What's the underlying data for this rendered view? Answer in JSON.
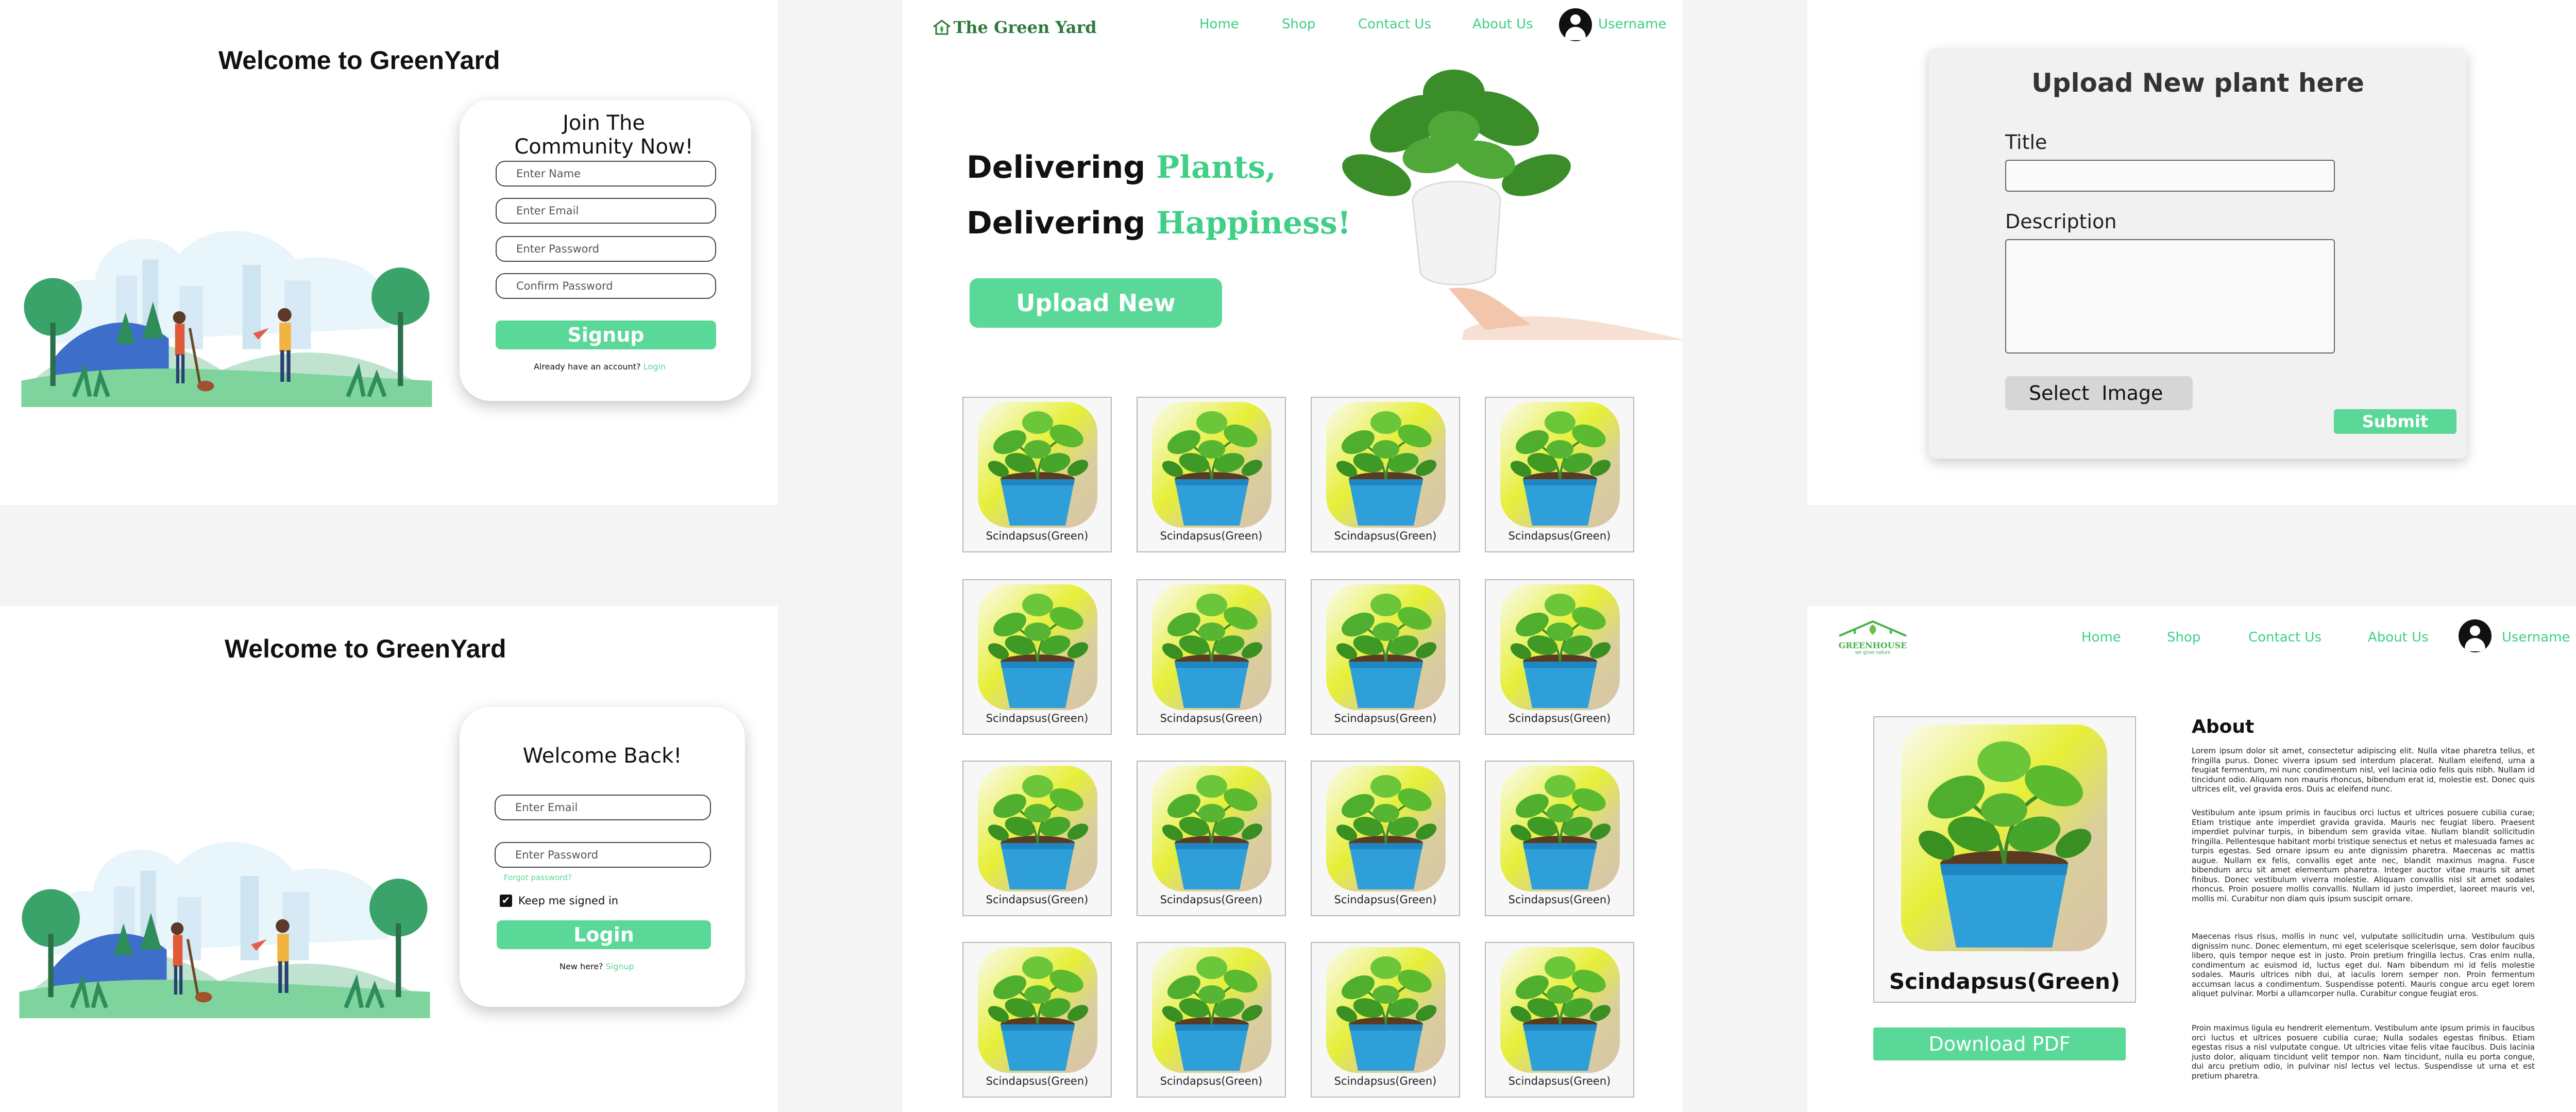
{
  "signup": {
    "title": "Welcome to GreenYard",
    "card_title": "Join The Community Now!",
    "name_placeholder": "Enter Name",
    "email_placeholder": "Enter Email",
    "password_placeholder": "Enter Password",
    "confirm_placeholder": "Confirm Password",
    "button": "Signup",
    "footer_text": "Already have an account?",
    "footer_link": "Login"
  },
  "login": {
    "title": "Welcome to GreenYard",
    "card_title": "Welcome Back!",
    "email_placeholder": "Enter Email",
    "password_placeholder": "Enter Password",
    "forgot": "Forgot password?",
    "keep_signed_in": "Keep me signed in",
    "keep_checked": true,
    "button": "Login",
    "footer_text": "New here?",
    "footer_link": "Signup"
  },
  "home": {
    "brand": "The Green Yard",
    "nav": [
      "Home",
      "Shop",
      "Contact Us",
      "About Us"
    ],
    "username": "Username",
    "hero_line1_prefix": "Delivering",
    "hero_line1_accent": "Plants,",
    "hero_line2_prefix": "Delivering",
    "hero_line2_accent": "Happiness!",
    "upload_button": "Upload New",
    "plants": [
      "Scindapsus(Green)",
      "Scindapsus(Green)",
      "Scindapsus(Green)",
      "Scindapsus(Green)",
      "Scindapsus(Green)",
      "Scindapsus(Green)",
      "Scindapsus(Green)",
      "Scindapsus(Green)",
      "Scindapsus(Green)",
      "Scindapsus(Green)",
      "Scindapsus(Green)",
      "Scindapsus(Green)",
      "Scindapsus(Green)",
      "Scindapsus(Green)",
      "Scindapsus(Green)",
      "Scindapsus(Green)"
    ]
  },
  "upload": {
    "heading": "Upload New plant here",
    "title_label": "Title",
    "description_label": "Description",
    "select_image": "Select  Image",
    "submit": "Submit"
  },
  "detail": {
    "logo_text": "GREENHOUSE",
    "logo_tagline": "we grow nature",
    "nav": [
      "Home",
      "Shop",
      "Contact Us",
      "About Us"
    ],
    "username": "Username",
    "plant_name": "Scindapsus(Green)",
    "download": "Download PDF",
    "about_heading": "About",
    "about_paragraphs": [
      "Lorem ipsum dolor sit amet, consectetur adipiscing elit. Nulla vitae pharetra tellus, et fringilla purus. Donec viverra ipsum sed interdum placerat. Nullam eleifend, urna a feugiat fermentum, mi nunc condimentum nisl, vel lacinia odio felis quis nibh. Nullam id tincidunt odio. Aliquam non mauris rhoncus, bibendum erat id, molestie est. Donec quis ultrices elit, vel gravida eros. Duis ac eleifend nunc.",
      "Vestibulum ante ipsum primis in faucibus orci luctus et ultrices posuere cubilia curae; Etiam tristique ante imperdiet gravida gravida. Mauris nec feugiat libero. Praesent imperdiet pulvinar turpis, in bibendum sem gravida vitae. Nullam blandit sollicitudin fringilla. Pellentesque habitant morbi tristique senectus et netus et malesuada fames ac turpis egestas. Sed ornare ipsum eu ante dignissim pharetra. Maecenas ac mattis augue. Nullam ex felis, convallis eget ante nec, blandit maximus magna. Fusce bibendum arcu sit amet elementum pharetra. Integer auctor vitae mauris sit amet finibus. Donec vestibulum viverra molestie. Aliquam convallis nisl sit amet sodales rhoncus. Proin posuere mollis convallis. Nullam id justo imperdiet, laoreet mauris vel, mollis mi. Curabitur non diam quis ipsum suscipit ornare.",
      "Maecenas risus risus, mollis in nunc vel, vulputate sollicitudin urna. Vestibulum quis dignissim nunc. Donec elementum, mi eget scelerisque scelerisque, sem dolor faucibus libero, quis tempor neque est in justo. Proin pretium fringilla lectus. Cras enim nulla, condimentum ac euismod id, luctus eget dui. Nam bibendum mi id felis molestie sodales. Mauris ultrices nibh dui, at iaculis lorem semper non. Proin fermentum accumsan lacus a condimentum. Suspendisse potenti. Mauris congue arcu eget lorem aliquet pulvinar. Morbi a ullamcorper nulla. Curabitur congue feugiat eros.",
      "Proin maximus ligula eu hendrerit elementum. Vestibulum ante ipsum primis in faucibus orci luctus et ultrices posuere cubilia curae; Nulla sodales egestas finibus. Etiam egestas risus a nisl vulputate congue. Ut ultricies vitae felis vitae faucibus. Duis lacinia justo dolor, aliquam tincidunt velit tempor non. Nam tincidunt, nulla eu porta congue, dui arcu pretium odio, in pulvinar nisl lectus vel lectus. Suspendisse ut urna et est pretium pharetra."
    ]
  },
  "colors": {
    "accent": "#5ad897",
    "accent_text": "#3fcf87",
    "background": "#f4f4f4"
  }
}
